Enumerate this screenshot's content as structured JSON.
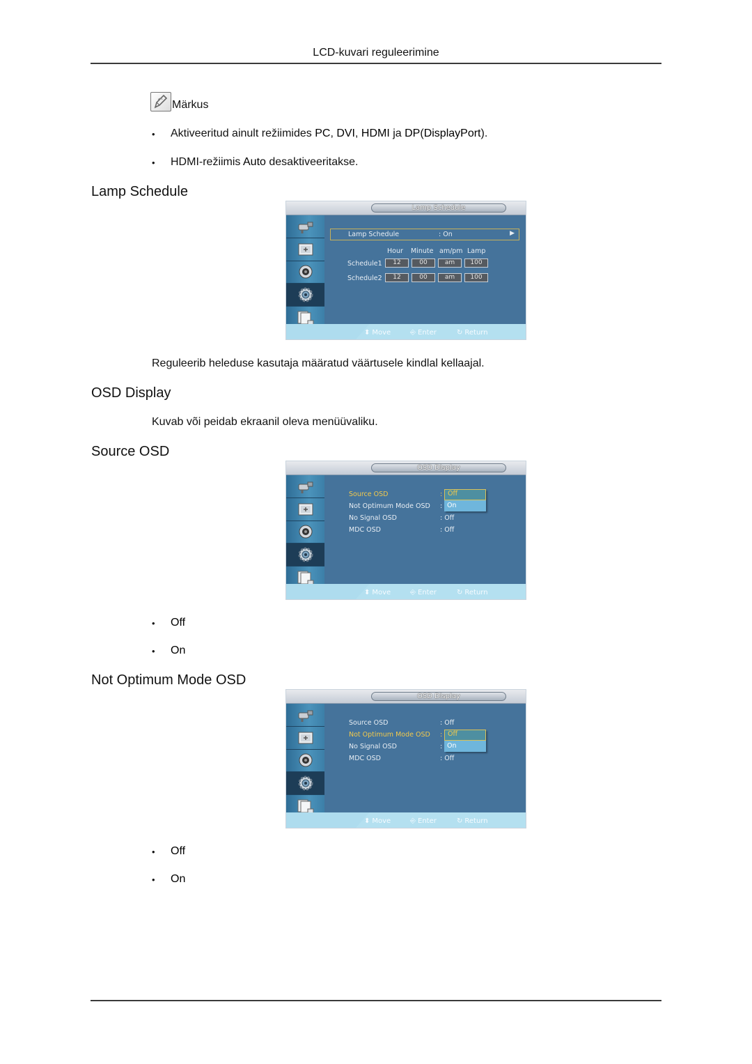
{
  "header": {
    "title": "LCD-kuvari reguleerimine"
  },
  "note": {
    "icon": "note-pencil-icon",
    "label": "Märkus",
    "items": [
      {
        "parts": [
          "Aktiveeritud ainult režiimides ",
          "PC",
          ", ",
          "DVI",
          ", ",
          "HDMI",
          " ja ",
          "DP",
          "(",
          "DisplayPort",
          ")."
        ]
      },
      {
        "parts": [
          "HDMI-režiimis ",
          "Auto",
          " desaktiveeritakse."
        ]
      }
    ]
  },
  "sections": {
    "lamp_schedule": {
      "heading": "Lamp Schedule",
      "description": "Reguleerib heleduse kasutaja määratud väärtusele kindlal kellaajal."
    },
    "osd_display": {
      "heading": "OSD Display",
      "description": "Kuvab või peidab ekraanil oleva menüüvaliku."
    },
    "source_osd": {
      "heading": "Source OSD",
      "options": [
        "Off",
        "On"
      ]
    },
    "not_optimum": {
      "heading": "Not Optimum Mode OSD",
      "options": [
        "Off",
        "On"
      ]
    }
  },
  "osd_common": {
    "sidebar_icons": [
      "input-plug-icon",
      "picture-icon",
      "sound-speaker-icon",
      "setup-gear-icon",
      "multi-screen-icon"
    ],
    "active_sidebar_index": 3,
    "footer": {
      "move": "Move",
      "enter": "Enter",
      "return": "Return"
    }
  },
  "screens": {
    "lamp": {
      "title": "Lamp Schedule",
      "row_label": "Lamp Schedule",
      "row_value": ": On",
      "columns": [
        "Hour",
        "Minute",
        "am/pm",
        "Lamp"
      ],
      "schedules": [
        {
          "label": "Schedule1",
          "values": [
            "12",
            "00",
            "am",
            "100"
          ]
        },
        {
          "label": "Schedule2",
          "values": [
            "12",
            "00",
            "am",
            "100"
          ]
        }
      ]
    },
    "source": {
      "title": "OSD Display",
      "rows": [
        {
          "label": "Source OSD",
          "value": ":"
        },
        {
          "label": "Not Optimum Mode OSD",
          "value": ":"
        },
        {
          "label": "No Signal OSD",
          "value": ": Off"
        },
        {
          "label": "MDC OSD",
          "value": ": Off"
        }
      ],
      "selected_row": 0,
      "dropdown": [
        "Off",
        "On"
      ],
      "dropdown_selected": "Off"
    },
    "notopt": {
      "title": "OSD Display",
      "rows": [
        {
          "label": "Source OSD",
          "value": ": Off"
        },
        {
          "label": "Not Optimum Mode OSD",
          "value": ":"
        },
        {
          "label": "No Signal OSD",
          "value": ":"
        },
        {
          "label": "MDC OSD",
          "value": ": Off"
        }
      ],
      "selected_row": 1,
      "dropdown": [
        "Off",
        "On"
      ],
      "dropdown_selected": "Off"
    }
  }
}
